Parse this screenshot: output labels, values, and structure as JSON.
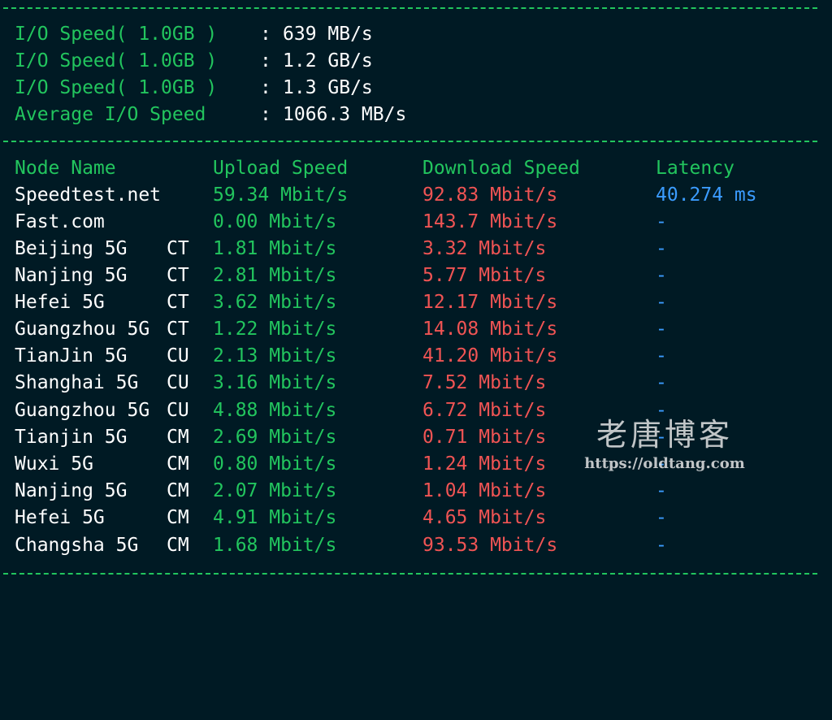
{
  "io": {
    "rows": [
      {
        "label": "I/O Speed( 1.0GB )",
        "value": "639 MB/s"
      },
      {
        "label": "I/O Speed( 1.0GB )",
        "value": "1.2 GB/s"
      },
      {
        "label": "I/O Speed( 1.0GB )",
        "value": "1.3 GB/s"
      },
      {
        "label": "Average I/O Speed",
        "value": "1066.3 MB/s"
      }
    ],
    "colon": ":"
  },
  "table": {
    "headers": {
      "node": "Node Name",
      "upload": "Upload Speed",
      "download": "Download Speed",
      "latency": "Latency"
    },
    "rows": [
      {
        "node": "Speedtest.net",
        "isp": "",
        "upload": "59.34 Mbit/s",
        "download": "92.83 Mbit/s",
        "latency": "40.274 ms"
      },
      {
        "node": "Fast.com",
        "isp": "",
        "upload": "0.00 Mbit/s",
        "download": "143.7 Mbit/s",
        "latency": "-"
      },
      {
        "node": "Beijing 5G",
        "isp": "CT",
        "upload": "1.81 Mbit/s",
        "download": "3.32 Mbit/s",
        "latency": "-"
      },
      {
        "node": "Nanjing 5G",
        "isp": "CT",
        "upload": "2.81 Mbit/s",
        "download": "5.77 Mbit/s",
        "latency": "-"
      },
      {
        "node": "Hefei 5G",
        "isp": "CT",
        "upload": "3.62 Mbit/s",
        "download": "12.17 Mbit/s",
        "latency": "-"
      },
      {
        "node": "Guangzhou 5G",
        "isp": "CT",
        "upload": "1.22 Mbit/s",
        "download": "14.08 Mbit/s",
        "latency": "-"
      },
      {
        "node": "TianJin 5G",
        "isp": "CU",
        "upload": "2.13 Mbit/s",
        "download": "41.20 Mbit/s",
        "latency": "-"
      },
      {
        "node": "Shanghai 5G",
        "isp": "CU",
        "upload": "3.16 Mbit/s",
        "download": "7.52 Mbit/s",
        "latency": "-"
      },
      {
        "node": "Guangzhou 5G",
        "isp": "CU",
        "upload": "4.88 Mbit/s",
        "download": "6.72 Mbit/s",
        "latency": "-"
      },
      {
        "node": "Tianjin 5G",
        "isp": "CM",
        "upload": "2.69 Mbit/s",
        "download": "0.71 Mbit/s",
        "latency": "-"
      },
      {
        "node": "Wuxi 5G",
        "isp": "CM",
        "upload": "0.80 Mbit/s",
        "download": "1.24 Mbit/s",
        "latency": "-"
      },
      {
        "node": "Nanjing 5G",
        "isp": "CM",
        "upload": "2.07 Mbit/s",
        "download": "1.04 Mbit/s",
        "latency": "-"
      },
      {
        "node": "Hefei 5G",
        "isp": "CM",
        "upload": "4.91 Mbit/s",
        "download": "4.65 Mbit/s",
        "latency": "-"
      },
      {
        "node": "Changsha 5G",
        "isp": "CM",
        "upload": "1.68 Mbit/s",
        "download": "93.53 Mbit/s",
        "latency": "-"
      }
    ]
  },
  "watermark": {
    "title": "老唐博客",
    "url": "https://oldtang.com"
  },
  "colors": {
    "background": "#001a24",
    "green": "#22c55e",
    "red": "#f05454",
    "blue": "#3b9cff",
    "white": "#ffffff"
  }
}
